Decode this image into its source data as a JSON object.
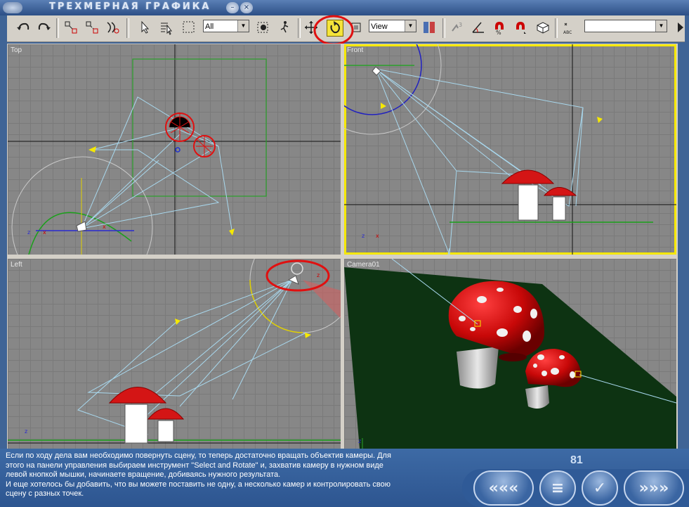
{
  "window": {
    "title": "ТРЕХМЕРНАЯ ГРАФИКА",
    "min_icon": "minimize-icon",
    "close_icon": "close-icon",
    "close_glyph": "×",
    "min_glyph": "–"
  },
  "toolbar": {
    "selection_filter": "All",
    "reference_coord": "View",
    "named_selection": "",
    "icons": [
      "undo-icon",
      "redo-icon",
      "link-icon",
      "unlink-icon",
      "bind-space-warp-icon",
      "select-icon",
      "select-by-name-icon",
      "rect-region-icon",
      "window-crossing-icon",
      "select-move-icon",
      "select-rotate-icon",
      "select-scale-icon",
      "pivot-icon",
      "mirror-icon",
      "snap-icon",
      "angle-snap-icon",
      "percent-snap-icon",
      "spinner-snap-icon",
      "edit-named-icon",
      "align-icon",
      "spelling-icon"
    ],
    "highlighted_tool": "select-rotate-icon"
  },
  "viewports": [
    {
      "label": "Top"
    },
    {
      "label": "Front"
    },
    {
      "label": "Left"
    },
    {
      "label": "Camera01"
    }
  ],
  "info": {
    "lines": [
      "Если по ходу дела вам необходимо повернуть сцену, то теперь достаточно вращать объектив камеры. Для",
      "этого на панели управления выбираем инструмент \"Select and Rotate\" и, захватив камеру в нужном виде",
      "левой кнопкой мышки, начинаете вращение, добиваясь нужного результата.",
      "И еще хотелось бы добавить, что вы можете поставить не одну, а несколько камер и контролировать свою",
      "сцену с разных точек."
    ]
  },
  "page_number": "81",
  "nav": {
    "prev_glyph": "«««",
    "contents_glyph": "≡",
    "check_glyph": "✓",
    "next_glyph": "»»»"
  },
  "colors": {
    "accent_red": "#e01010",
    "viewport_bg": "#878787",
    "active_border": "#f5e800",
    "wire_cyan": "#a8d8ee",
    "mushroom_red": "#d41515"
  }
}
